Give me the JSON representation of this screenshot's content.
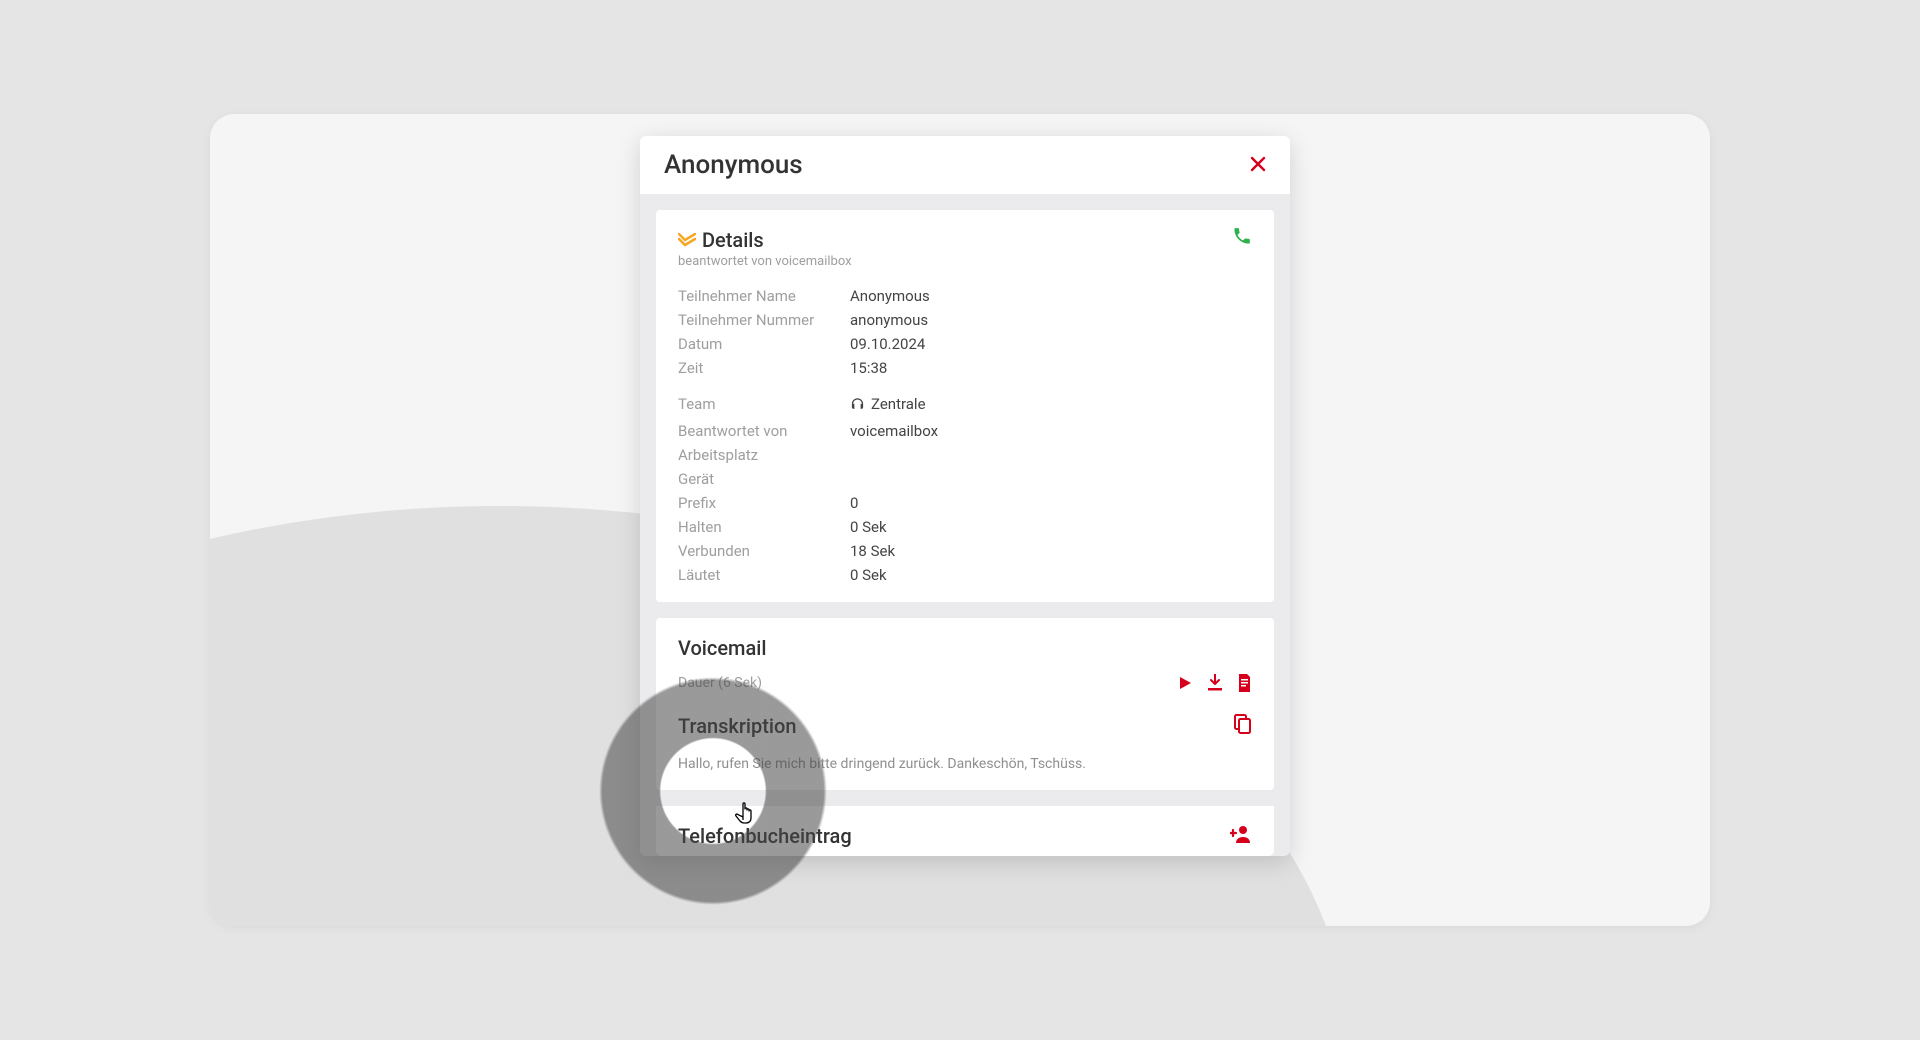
{
  "modal": {
    "title": "Anonymous"
  },
  "details": {
    "heading": "Details",
    "subtitle": "beantwortet von voicemailbox",
    "fields1": {
      "name_label": "Teilnehmer Name",
      "name_value": "Anonymous",
      "number_label": "Teilnehmer Nummer",
      "number_value": "anonymous",
      "date_label": "Datum",
      "date_value": "09.10.2024",
      "time_label": "Zeit",
      "time_value": "15:38"
    },
    "fields2": {
      "team_label": "Team",
      "team_value": "Zentrale",
      "answered_label": "Beantwortet von",
      "answered_value": "voicemailbox",
      "workplace_label": "Arbeitsplatz",
      "workplace_value": "",
      "device_label": "Gerät",
      "device_value": "",
      "prefix_label": "Prefix",
      "prefix_value": "0",
      "hold_label": "Halten",
      "hold_value": "0 Sek",
      "connected_label": "Verbunden",
      "connected_value": "18 Sek",
      "ringing_label": "Läutet",
      "ringing_value": "0 Sek"
    }
  },
  "voicemail": {
    "heading": "Voicemail",
    "duration": "Dauer (6 Sek)"
  },
  "transcription": {
    "heading": "Transkription",
    "text": "Hallo, rufen Sie mich bitte dringend zurück. Dankeschön, Tschüss."
  },
  "phonebook": {
    "heading": "Telefonbucheintrag"
  }
}
